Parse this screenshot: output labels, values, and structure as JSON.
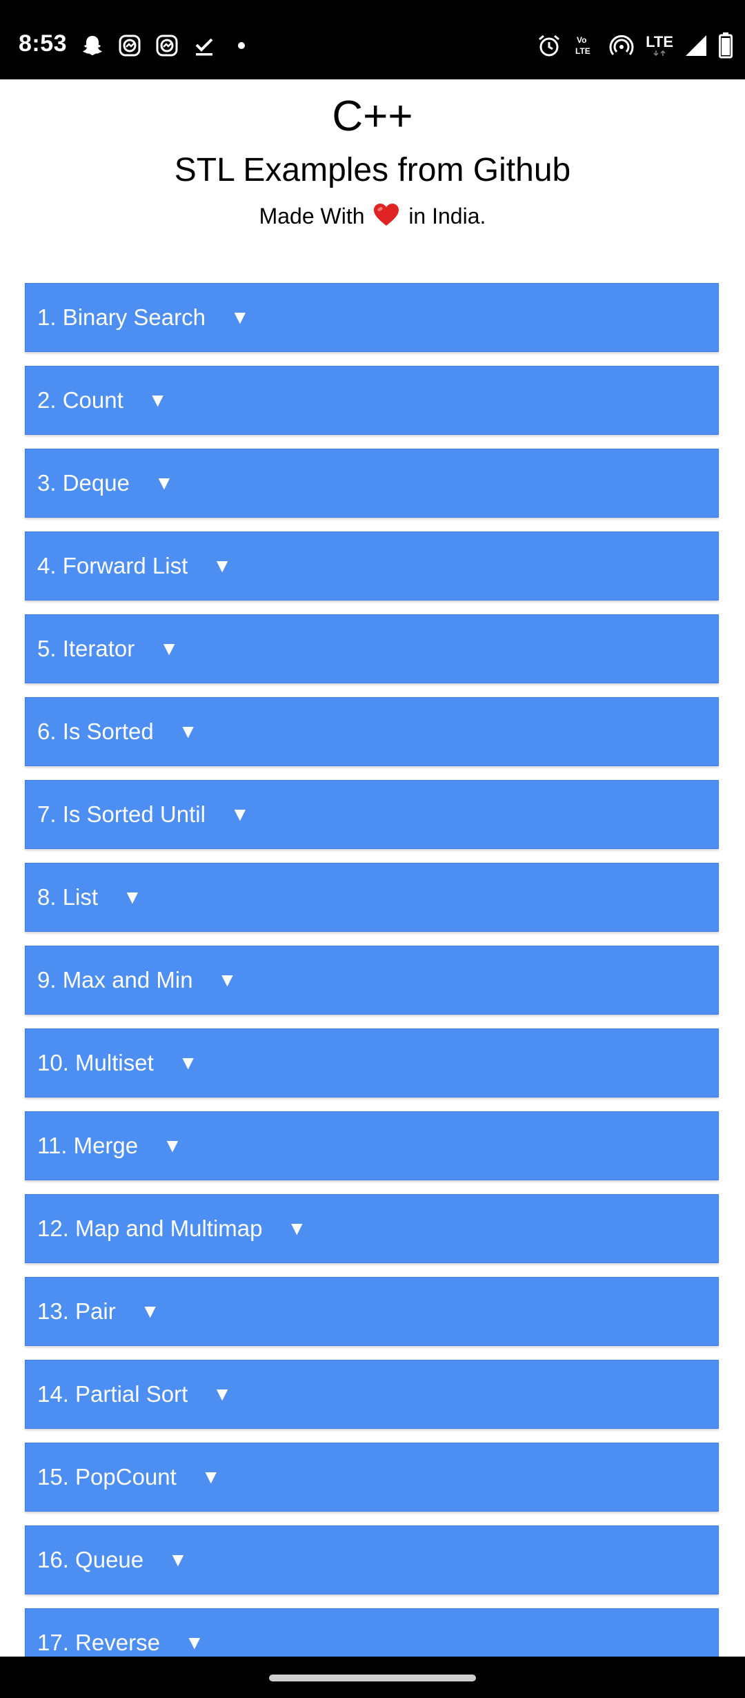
{
  "status_bar": {
    "time": "8:53",
    "network_label": "LTE",
    "left_icons": [
      "snapchat-icon",
      "messenger-bubble-icon",
      "messenger-bubble-icon",
      "check-done-icon",
      "dot-icon"
    ],
    "right_icons": [
      "alarm-icon",
      "volte-icon",
      "hotspot-icon",
      "lte-icon",
      "signal-icon",
      "battery-icon"
    ]
  },
  "header": {
    "title": "C++",
    "subtitle": "STL Examples from Github",
    "tagline_before": "Made With",
    "tagline_after": "in India."
  },
  "arrow_glyph": "▼",
  "items": [
    {
      "label": "1. Binary Search"
    },
    {
      "label": "2. Count"
    },
    {
      "label": "3. Deque"
    },
    {
      "label": "4. Forward List"
    },
    {
      "label": "5. Iterator"
    },
    {
      "label": "6. Is Sorted"
    },
    {
      "label": "7. Is Sorted Until"
    },
    {
      "label": "8. List"
    },
    {
      "label": "9. Max and Min"
    },
    {
      "label": "10. Multiset"
    },
    {
      "label": "11. Merge"
    },
    {
      "label": "12. Map and Multimap"
    },
    {
      "label": "13. Pair"
    },
    {
      "label": "14. Partial Sort"
    },
    {
      "label": "15. PopCount"
    },
    {
      "label": "16. Queue"
    },
    {
      "label": "17. Reverse"
    }
  ],
  "colors": {
    "item_background": "#4d8ef3",
    "heart": "#e02424"
  }
}
